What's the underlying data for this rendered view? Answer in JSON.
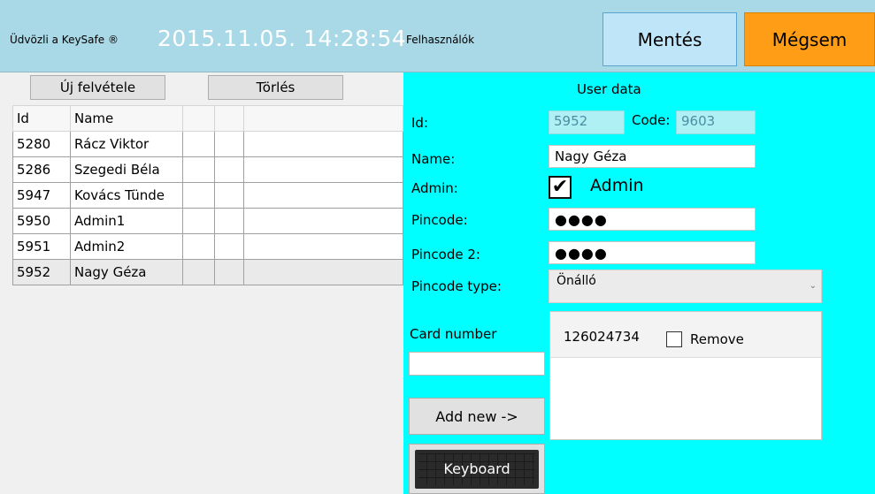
{
  "header": {
    "welcome": "Üdvözli a KeySafe ®",
    "datetime": "2015.11.05. 14:28:54",
    "users_label": "Felhasználók",
    "save_label": "Mentés",
    "cancel_label": "Mégsem"
  },
  "toolbar": {
    "new_label": "Új felvétele",
    "delete_label": "Törlés"
  },
  "grid": {
    "columns": [
      "Id",
      "Name",
      "",
      ""
    ],
    "rows": [
      {
        "id": "5280",
        "name": "Rácz Viktor"
      },
      {
        "id": "5286",
        "name": "Szegedi Béla"
      },
      {
        "id": "5947",
        "name": "Kovács Tünde"
      },
      {
        "id": "5950",
        "name": "Admin1"
      },
      {
        "id": "5951",
        "name": "Admin2"
      },
      {
        "id": "5952",
        "name": "Nagy Géza"
      }
    ]
  },
  "user_data": {
    "title": "User data",
    "id_label": "Id:",
    "id_value": "5952",
    "code_label": "Code:",
    "code_value": "9603",
    "name_label": "Name:",
    "name_value": "Nagy Géza",
    "admin_label": "Admin:",
    "admin_checkbox_label": "Admin",
    "admin_checked": true,
    "pincode_label": "Pincode:",
    "pincode_value": "●●●●",
    "pincode2_label": "Pincode 2:",
    "pincode2_value": "●●●●",
    "pincode_type_label": "Pincode type:",
    "pincode_type_value": "Önálló",
    "card_number_label": "Card number",
    "card_number_input": "",
    "cards": [
      {
        "number": "126024734",
        "remove_label": "Remove",
        "remove_checked": false
      }
    ],
    "add_new_label": "Add new ->",
    "keyboard_label": "Keyboard"
  },
  "colors": {
    "header_bg": "#a9d8e6",
    "panel_bg": "#00ffff",
    "save_bg": "#bfe6f8",
    "cancel_bg": "#ff9e16"
  }
}
